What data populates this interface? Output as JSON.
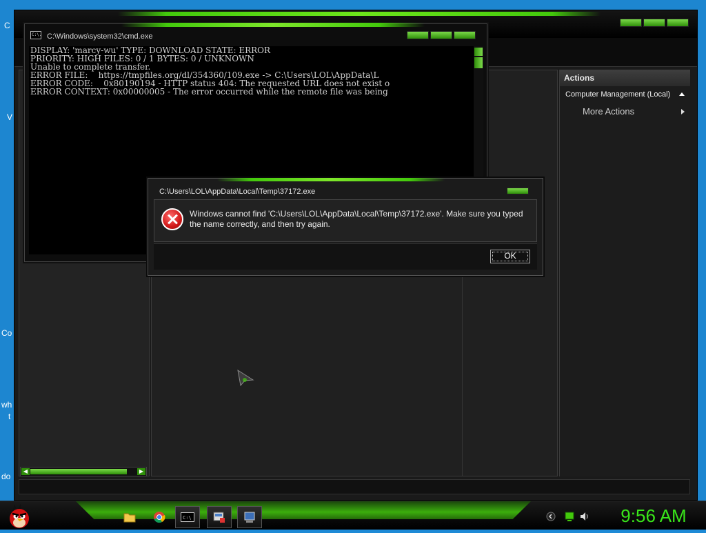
{
  "desktop": {
    "fragments": [
      "C",
      "V",
      "Co",
      "wh",
      "t",
      "do"
    ]
  },
  "computer_management": {
    "actions_header": "Actions",
    "actions_item": "Computer Management (Local)",
    "more_actions": "More Actions"
  },
  "cmd": {
    "title": "C:\\Windows\\system32\\cmd.exe",
    "icon_text": "C:\\.",
    "lines": [
      "DISPLAY: 'marcy-wu' TYPE: DOWNLOAD STATE: ERROR",
      "PRIORITY: HIGH FILES: 0 / 1 BYTES: 0 / UNKNOWN",
      "Unable to complete transfer.",
      "ERROR FILE:    https://tmpfiles.org/dl/354360/109.exe -> C:\\Users\\LOL\\AppData\\L",
      "ERROR CODE:    0x80190194 - HTTP status 404: The requested URL does not exist o",
      "ERROR CONTEXT: 0x00000005 - The error occurred while the remote file was being"
    ]
  },
  "dialog": {
    "title": "C:\\Users\\LOL\\AppData\\Local\\Temp\\37172.exe",
    "message": "Windows cannot find 'C:\\Users\\LOL\\AppData\\Local\\Temp\\37172.exe'. Make sure you typed the name correctly, and then try again.",
    "ok_label": "OK"
  },
  "taskbar": {
    "icon_names": [
      "angry-bird-start-icon",
      "folder-icon",
      "chrome-icon",
      "cmd-icon",
      "computer-management-icon",
      "system-icon"
    ],
    "tray_icon_names": [
      "arrow-icon",
      "network-icon",
      "volume-icon"
    ],
    "clock": "9:56 AM"
  },
  "colors": {
    "accent_green": "#43c90c",
    "clock_green": "#39e61a",
    "desktop_blue": "#1d86d0",
    "error_red": "#d11818"
  }
}
